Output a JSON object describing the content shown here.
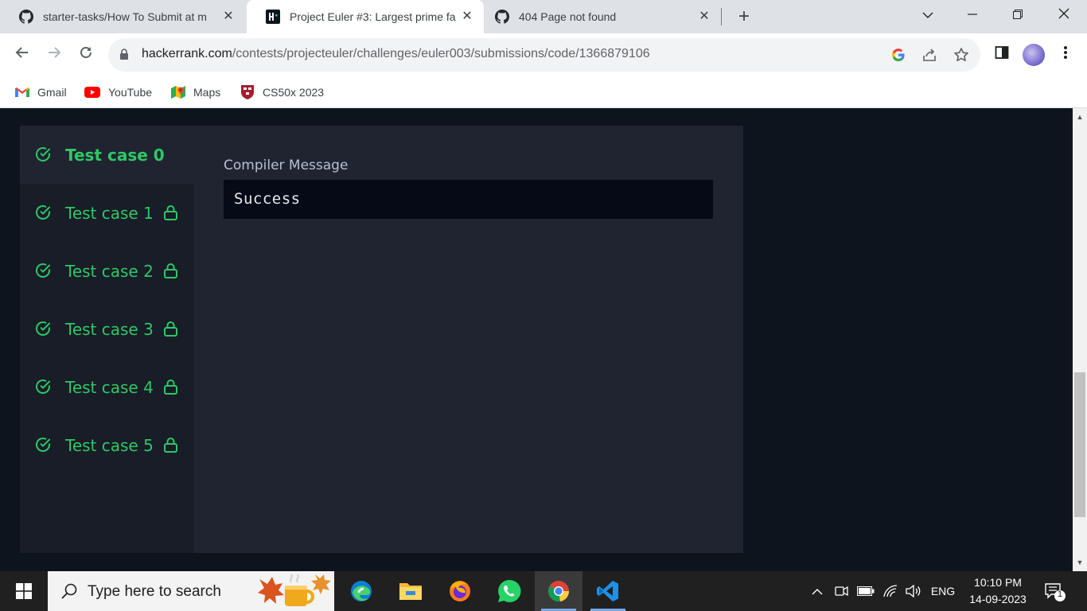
{
  "browser": {
    "tabs": [
      {
        "title": "starter-tasks/How To Submit at m",
        "favicon": "github-icon",
        "active": false
      },
      {
        "title": "Project Euler #3: Largest prime fa",
        "favicon": "hackerrank-icon",
        "active": true
      },
      {
        "title": "404 Page not found",
        "favicon": "github-icon",
        "active": false
      }
    ],
    "url": {
      "host": "hackerrank.com",
      "path": "/contests/projecteuler/challenges/euler003/submissions/code/1366879106"
    },
    "bookmarks": [
      {
        "label": "Gmail",
        "icon": "gmail-icon"
      },
      {
        "label": "YouTube",
        "icon": "youtube-icon"
      },
      {
        "label": "Maps",
        "icon": "maps-icon"
      },
      {
        "label": "CS50x 2023",
        "icon": "harvard-shield-icon"
      }
    ]
  },
  "testcases": [
    {
      "label": "Test case 0",
      "status": "passed",
      "locked": false,
      "active": true
    },
    {
      "label": "Test case 1",
      "status": "passed",
      "locked": true,
      "active": false
    },
    {
      "label": "Test case 2",
      "status": "passed",
      "locked": true,
      "active": false
    },
    {
      "label": "Test case 3",
      "status": "passed",
      "locked": true,
      "active": false
    },
    {
      "label": "Test case 4",
      "status": "passed",
      "locked": true,
      "active": false
    },
    {
      "label": "Test case 5",
      "status": "passed",
      "locked": true,
      "active": false
    }
  ],
  "compiler": {
    "label": "Compiler Message",
    "value": "Success"
  },
  "taskbar": {
    "search_placeholder": "Type here to search",
    "apps": [
      "edge-icon",
      "file-explorer-icon",
      "firefox-icon",
      "whatsapp-icon",
      "chrome-icon",
      "vscode-icon"
    ],
    "language": "ENG",
    "time": "10:10 PM",
    "date": "14-09-2023",
    "notification_count": "1"
  },
  "colors": {
    "accent_green": "#2ec866",
    "page_bg": "#0e141e",
    "panel_bg": "#1f2430"
  }
}
